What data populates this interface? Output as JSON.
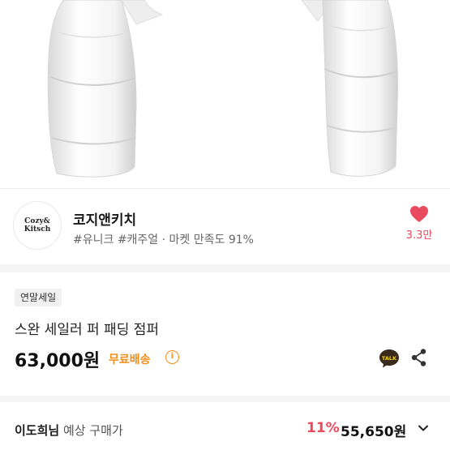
{
  "shop": {
    "logo_line1": "Cozy&",
    "logo_line2": "Kitsch",
    "name": "코지앤키치",
    "tags": "#유니크 #캐주얼 · 마켓 만족도 91%",
    "like_count": "3.3만",
    "like_color": "#e84b5e"
  },
  "product": {
    "badge": "연말세일",
    "title": "스완 세일러 퍼 패딩 점퍼",
    "price": "63,000원",
    "shipping": "무료배송",
    "info_glyph": "i",
    "shipping_color": "#f28e1a",
    "talk_label": "TALK"
  },
  "estimate": {
    "name": "이도희님",
    "suffix": " 예상 구매가",
    "discount": "11%",
    "price": "55,650원",
    "discount_color": "#e84b5e"
  },
  "icons": {
    "heart": "heart-icon",
    "kakao_talk": "kakao-talk-icon",
    "share": "share-icon",
    "chevron": "chevron-down-icon",
    "info": "info-icon"
  }
}
